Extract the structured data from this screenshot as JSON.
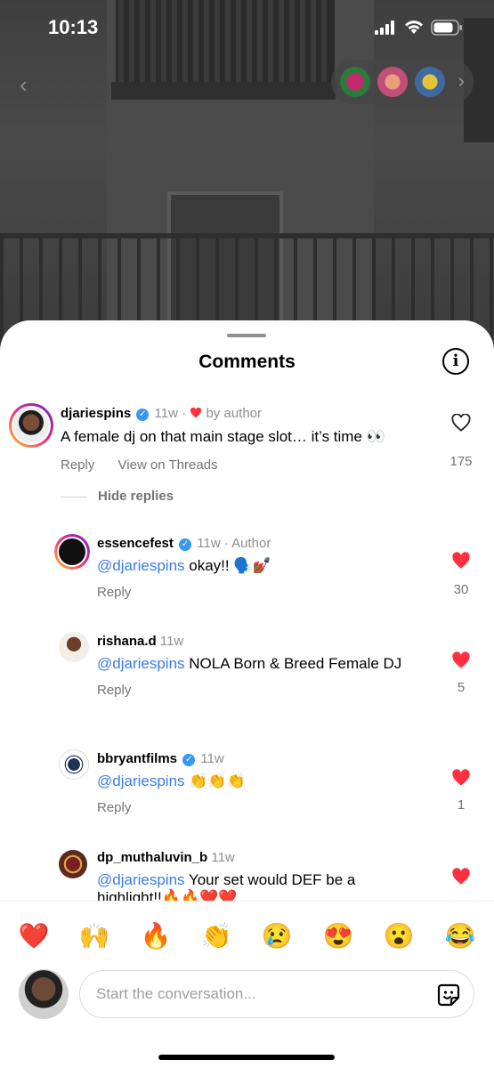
{
  "status_bar": {
    "time": "10:13"
  },
  "sheet": {
    "title": "Comments"
  },
  "comments": [
    {
      "username": "djariespins",
      "age": "11w",
      "author_like": "by author",
      "text": "A female dj on that main stage slot… it’s time 👀",
      "actions": [
        "Reply",
        "View on Threads"
      ],
      "likes": "175",
      "liked": false
    }
  ],
  "hide_replies_label": "Hide replies",
  "replies": [
    {
      "username": "essencefest",
      "age": "11w",
      "tag": "Author",
      "mention": "@djariespins",
      "text": " okay!! 🗣️💅🏾",
      "reply": "Reply",
      "likes": "30",
      "liked": true
    },
    {
      "username": "rishana.d",
      "age": "11w",
      "mention": "@djariespins",
      "text": " NOLA Born & Breed Female DJ",
      "reply": "Reply",
      "likes": "5",
      "liked": true
    },
    {
      "username": "bbryantfilms",
      "age": "11w",
      "mention": "@djariespins",
      "text": " 👏👏👏",
      "reply": "Reply",
      "likes": "1",
      "liked": true
    },
    {
      "username": "dp_muthaluvin_b",
      "age": "11w",
      "mention": "@djariespins",
      "text": " Your set would DEF be a",
      "text2": "highlight!!🔥🔥❤️❤️",
      "liked": true
    }
  ],
  "emoji_bar": [
    "❤️",
    "🙌",
    "🔥",
    "👏",
    "😢",
    "😍",
    "😮",
    "😂"
  ],
  "composer": {
    "placeholder": "Start the conversation..."
  },
  "icons": {
    "info": "info-icon",
    "sticker": "sticker-icon",
    "heart": "heart-icon",
    "verified": "verified-badge-icon"
  },
  "colors": {
    "accent_red": "#ff3040",
    "mention_blue": "#3b7be2",
    "verified_blue": "#3897f0"
  }
}
